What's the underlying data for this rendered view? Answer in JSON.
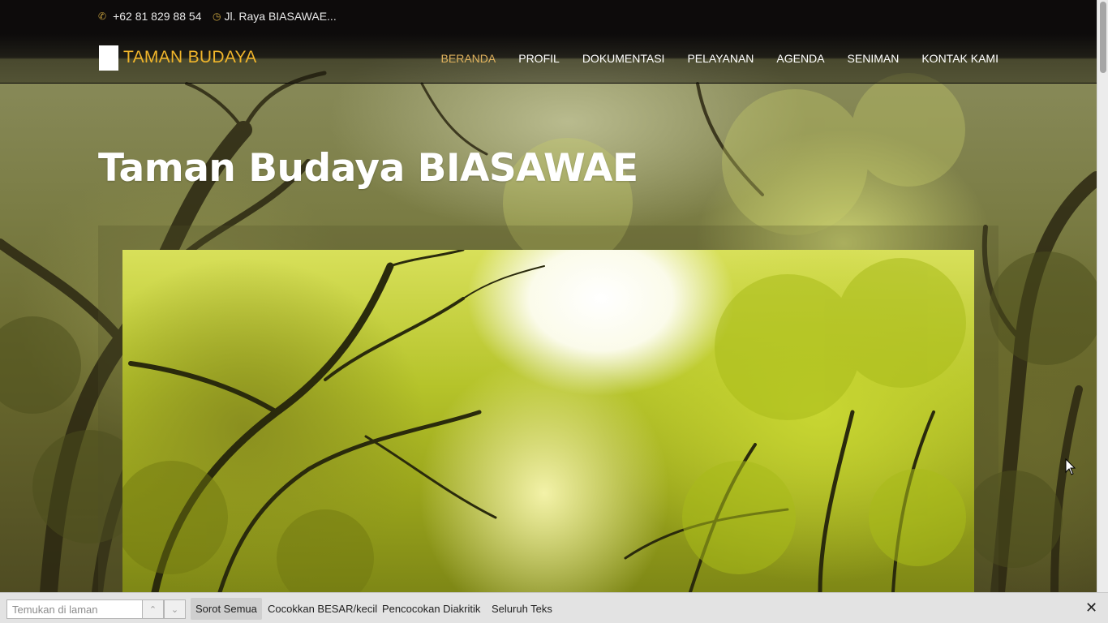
{
  "topbar": {
    "phone": "+62 81 829 88 54",
    "phone_icon": "phone-icon",
    "address": "Jl. Raya BIASAWAE...",
    "address_icon": "clock-icon"
  },
  "navbar": {
    "logo_text": "TAMAN BUDAYA",
    "menu": [
      {
        "label": "BERANDA",
        "active": true
      },
      {
        "label": "PROFIL",
        "active": false
      },
      {
        "label": "DOKUMENTASI",
        "active": false
      },
      {
        "label": "PELAYANAN",
        "active": false
      },
      {
        "label": "AGENDA",
        "active": false
      },
      {
        "label": "SENIMAN",
        "active": false
      },
      {
        "label": "KONTAK KAMI",
        "active": false
      }
    ]
  },
  "hero": {
    "title": "Taman Budaya BIASAWAE"
  },
  "findbar": {
    "placeholder": "Temukan di laman",
    "highlight_all": "Sorot Semua",
    "match_case": "Cocokkan BESAR/kecil",
    "match_diacritics": "Pencocokan Diakritik",
    "whole_words": "Seluruh Teks",
    "close_icon": "close-icon"
  },
  "colors": {
    "accent": "#f0b52b",
    "active_menu": "#e0b25e",
    "topbar_bg": "#0d0b0b"
  }
}
